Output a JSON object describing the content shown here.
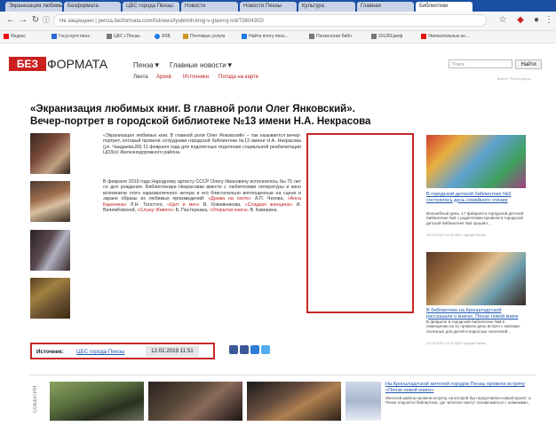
{
  "browser": {
    "tabs": [
      {
        "label": "Экранизация любимых книг"
      },
      {
        "label": "Безформата"
      },
      {
        "label": "ЦБС города Пензы"
      },
      {
        "label": "Новости"
      },
      {
        "label": "Новости Пензы"
      },
      {
        "label": "Культура"
      },
      {
        "label": "Главная"
      },
      {
        "label": "Библиотеки"
      }
    ],
    "url": "Не защищено | penza.bezformata.com/listnews/lyubimih-knig-v-glavnoj-roli/72804302/",
    "bookmarks": [
      {
        "label": "Яндекс",
        "color": "#e11"
      },
      {
        "label": "Госуслуги пенз.",
        "color": "#2a6bd6"
      },
      {
        "label": "ЦБС г.Пензы",
        "color": "#777"
      },
      {
        "label": "ЯЗБ",
        "color": "#1f7ce0"
      },
      {
        "label": "Почтовые услуги",
        "color": "#c92"
      },
      {
        "label": "Найти почту пенз...",
        "color": "#1f7ce0"
      },
      {
        "label": "Пензенская библ.",
        "color": "#777"
      },
      {
        "label": "2012КЦинф",
        "color": "#777"
      },
      {
        "label": "Увлекательные кн...",
        "color": "#e11"
      }
    ]
  },
  "site": {
    "logo_red": "БЕЗ",
    "logo_black": "ФОРМАТА",
    "menu_city": "Пенза▼",
    "menu_news": "Главные новости▼",
    "submenu": [
      "Лента",
      "Архив",
      "Источники",
      "Погода на карте"
    ],
    "search_placeholder": "Поиск",
    "search_button": "Найти",
    "right_small": "Войти / Регистрация"
  },
  "article": {
    "title": "«Экранизация любимых книг. В главной роли Олег Янковский». Вечер-портрет в городской библиотеке №13 имени Н.А. Некрасова",
    "para1": "«Экранизация любимых книг. В главной роли Олег Янковский» – так называется вечер-портрет, который провели сотрудники городской библиотеки №13 имени Н.А. Некрасова (ул. Чаадаева,89) 11 февраля года для подопечных отделения социальной реабилитации ЦОЗ(е) Железнодорожного района.",
    "para2_a": "В феврале 2019 года Народному артисту СССР Олегу Ивановичу исполнилось бы 75 лет со дня рождения. Библиотекари Некрасовки вместе с любителями литературы и кино вспомнили этого харизматичного актера и его блистательно воплощенные на сцене и экране образы из любимых произведений: ",
    "para2_links": [
      "«Драма на охоте»",
      "«Анна Каренина»",
      "«Щит и меч»",
      "«Сладкая женщина»",
      "«Служу Живого»",
      "«Открытая книга»"
    ],
    "para2_b1": " А.П. Чехова, ",
    "para2_b2": " Л.Н. Толстого, ",
    "para2_b3": " В. Кожевникова, ",
    "para2_b4": " И. Велембовской, ",
    "para2_b5": " Б. Пастернака, ",
    "para2_b6": " В. Каверина.",
    "source_label": "Источник:",
    "source_link": "ЦБС города Пензы",
    "source_date": "12.02.2019 11:51"
  },
  "sidebar": {
    "item1_link": "В городской детской библиотеке №3 состоялось день семейного чтения",
    "item1_text": "Волшебный день. 17 февраля в городской детской библиотеке №3 с родителями провели в городской детской библиотеке №3 прошёл...",
    "item1_date": "12.02.2019 11:51 ЦБС города Пензы",
    "item2_link": "В библиотеке на Кронштадтской рассказали о книгах, Пензе новой книги",
    "item2_text": "В феврале в городской библиотеке №8 в помещении на 11 провели день встреч с книгами, полезных для детей и взрослых читателей...",
    "item2_date": "12.02.2019 11:51 ЦБС города Пензы"
  },
  "bottom": {
    "vertical_label": "СОБЫТИЯ",
    "link": "На Кронштадтской жителей городов Пензы провели встречу «Пензе новой книги»",
    "text": "Жителей района провели встречу, на которой был представлен новый проект: в Пензе откроется библиотека, где читатели смогут познакомиться с новинками..."
  }
}
